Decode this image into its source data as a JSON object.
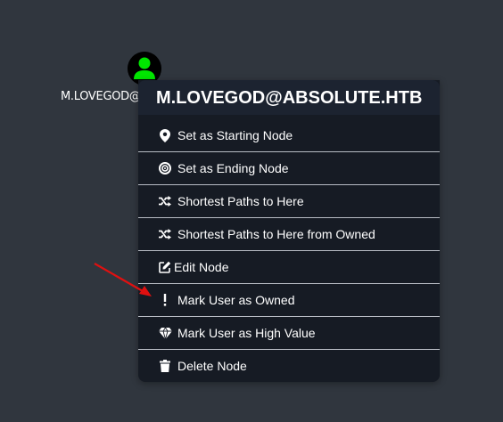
{
  "node": {
    "label": "M.LOVEGOD@ABSOLUTE.HTB",
    "icon": "user-icon",
    "icon_color": "#00e600"
  },
  "context_menu": {
    "title": "M.LOVEGOD@ABSOLUTE.HTB",
    "items": [
      {
        "label": "Set as Starting Node",
        "icon": "map-marker-icon"
      },
      {
        "label": "Set as Ending Node",
        "icon": "bullseye-icon"
      },
      {
        "label": "Shortest Paths to Here",
        "icon": "random-icon"
      },
      {
        "label": "Shortest Paths to Here from Owned",
        "icon": "random-icon"
      },
      {
        "label": "Edit Node",
        "icon": "edit-icon"
      },
      {
        "label": "Mark User as Owned",
        "icon": "exclamation-icon"
      },
      {
        "label": "Mark User as High Value",
        "icon": "gem-icon"
      },
      {
        "label": "Delete Node",
        "icon": "trash-icon"
      }
    ]
  },
  "colors": {
    "background": "#30363e",
    "menu_bg": "#161b24",
    "header_bg": "#1c2330",
    "annotation_arrow": "#e01010"
  }
}
